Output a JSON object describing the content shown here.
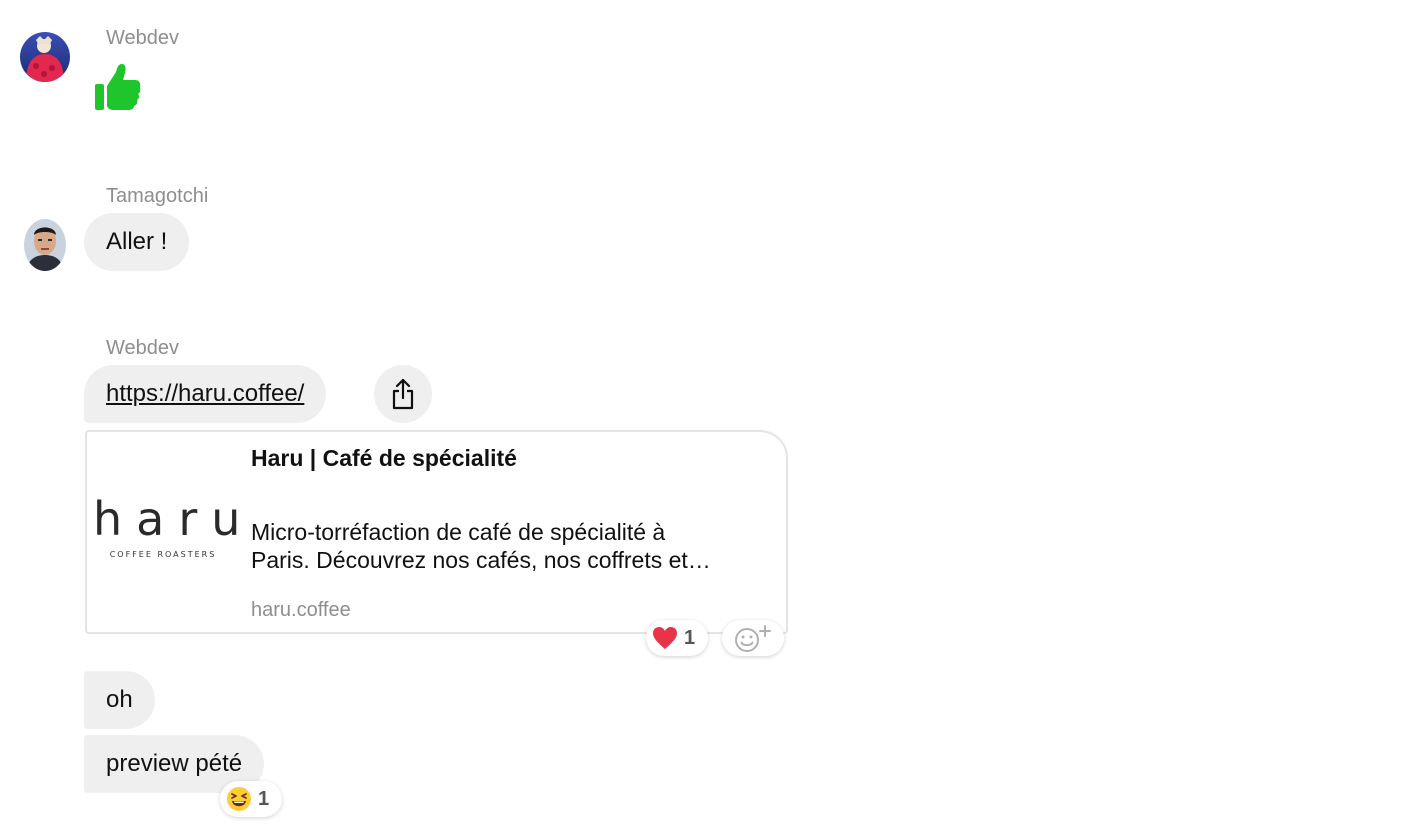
{
  "messages": [
    {
      "sender": "Webdev",
      "content_type": "emoji",
      "emoji_name": "thumbs-up-icon",
      "emoji_color": "#1fc62b"
    },
    {
      "sender": "Tamagotchi",
      "text": "Aller !"
    },
    {
      "sender": "Webdev",
      "link": "https://haru.coffee/",
      "preview": {
        "logo_wordmark": "haru",
        "logo_subtitle": "COFFEE ROASTERS",
        "title": "Haru | Café de spécialité",
        "description_line1": "Micro-torréfaction de café de spécialité à",
        "description_line2": "Paris. Découvrez nos cafés, nos coffrets et…",
        "domain": "haru.coffee"
      },
      "reactions": [
        {
          "emoji": "heart-icon",
          "count": "1",
          "color": "#e8334a"
        }
      ]
    },
    {
      "sender": "",
      "text": "oh"
    },
    {
      "sender": "",
      "text": "preview pété",
      "reactions": [
        {
          "emoji": "grinning-squinting-face-icon",
          "count": "1"
        }
      ]
    }
  ],
  "colors": {
    "bubble_bg": "#efefef",
    "sender_name": "#8e8e8e",
    "text": "#111111"
  }
}
